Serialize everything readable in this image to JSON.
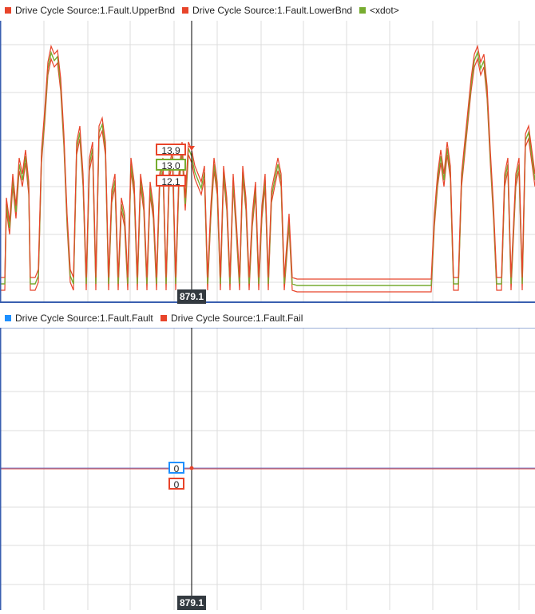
{
  "top_legend": [
    {
      "label": "Drive Cycle Source:1.Fault.UpperBnd",
      "color": "#e8442a"
    },
    {
      "label": "Drive Cycle Source:1.Fault.LowerBnd",
      "color": "#e8442a"
    },
    {
      "label": "<xdot>",
      "color": "#77ac30"
    }
  ],
  "bottom_legend": [
    {
      "label": "Drive Cycle Source:1.Fault.Fault",
      "color": "#1e90ff"
    },
    {
      "label": "Drive Cycle Source:1.Fault.Fail",
      "color": "#e8442a"
    }
  ],
  "cursor": {
    "time_label": "879.1",
    "top_values": {
      "upper": "13.9",
      "xdot": "13.0",
      "lower": "12.1"
    },
    "bottom_values": {
      "fault": "0",
      "fail": "0"
    }
  },
  "colors": {
    "upper": "#e8442a",
    "lower": "#e8442a",
    "xdot": "#77ac30",
    "fault": "#1e90ff",
    "fail": "#d9534f",
    "grid": "#dcdcdc",
    "frame": "#3a5fb0"
  }
}
